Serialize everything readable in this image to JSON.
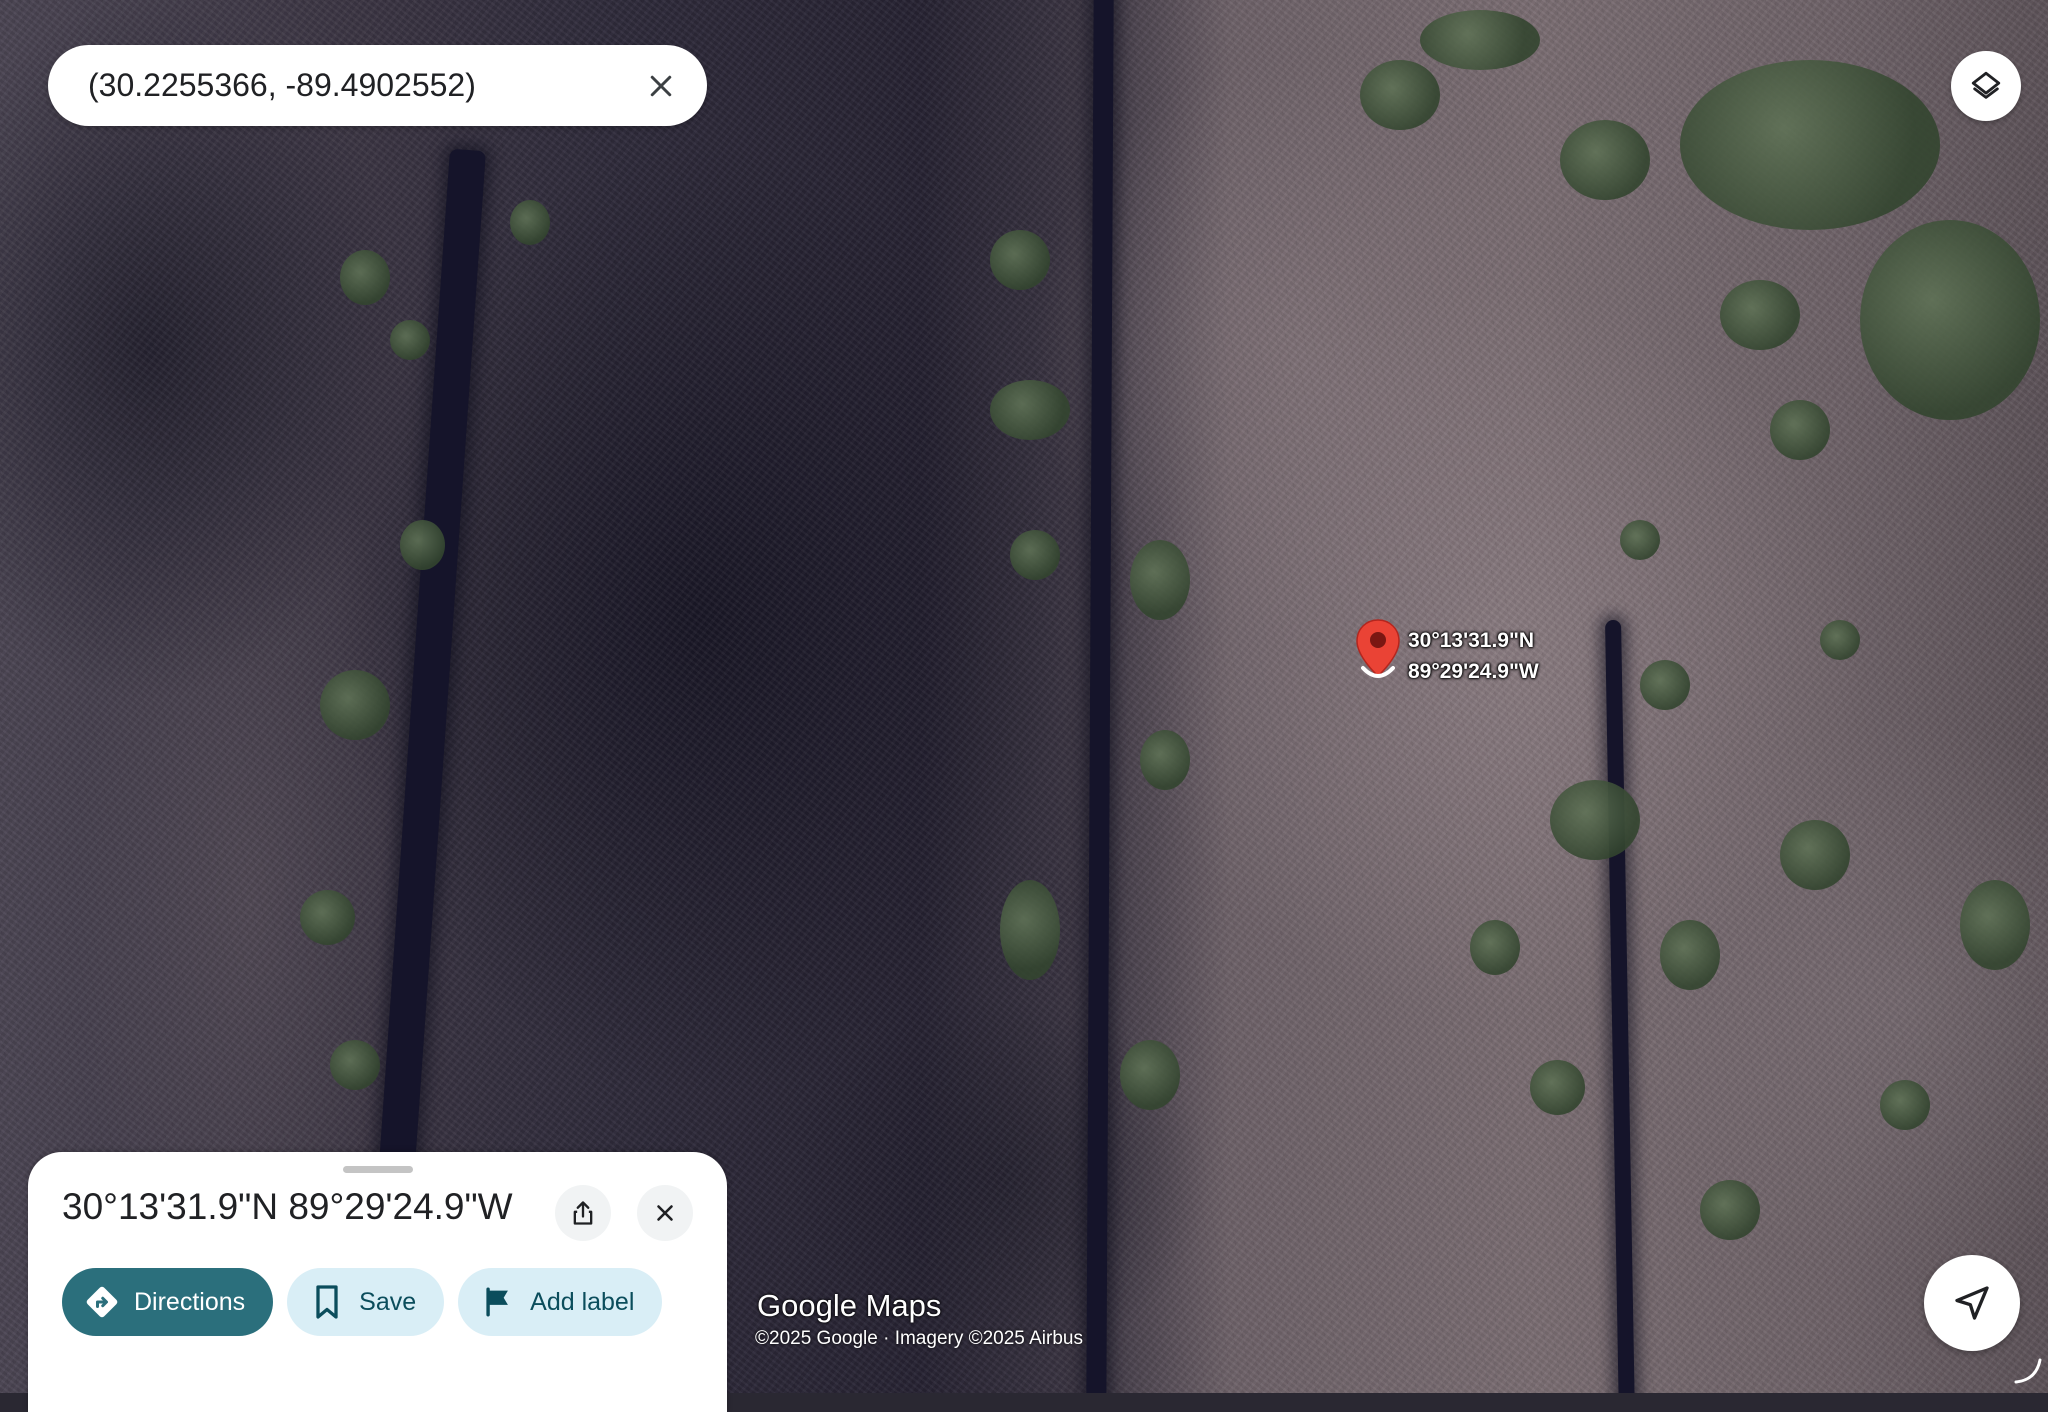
{
  "search": {
    "value": "(30.2255366, -89.4902552)",
    "clear_icon": "close-icon"
  },
  "map": {
    "type": "satellite",
    "layers_icon": "layers-icon",
    "marker": {
      "color": "#ea4335",
      "lat_label": "30°13'31.9\"N",
      "lng_label": "89°29'24.9\"W"
    },
    "logo_text": "Google Maps",
    "attribution": "©2025 Google · Imagery ©2025 Airbus",
    "locate_icon": "navigation-arrow-icon"
  },
  "place_sheet": {
    "title": "30°13'31.9\"N 89°29'24.9\"W",
    "share_icon": "share-icon",
    "close_icon": "close-icon",
    "actions": [
      {
        "label": "Directions",
        "icon": "directions-icon",
        "style": "primary"
      },
      {
        "label": "Save",
        "icon": "bookmark-icon",
        "style": "secondary"
      },
      {
        "label": "Add label",
        "icon": "flag-icon",
        "style": "secondary"
      }
    ]
  },
  "colors": {
    "primary_chip": "#2b6f7c",
    "secondary_chip": "#d9eef6",
    "marker": "#ea4335"
  }
}
